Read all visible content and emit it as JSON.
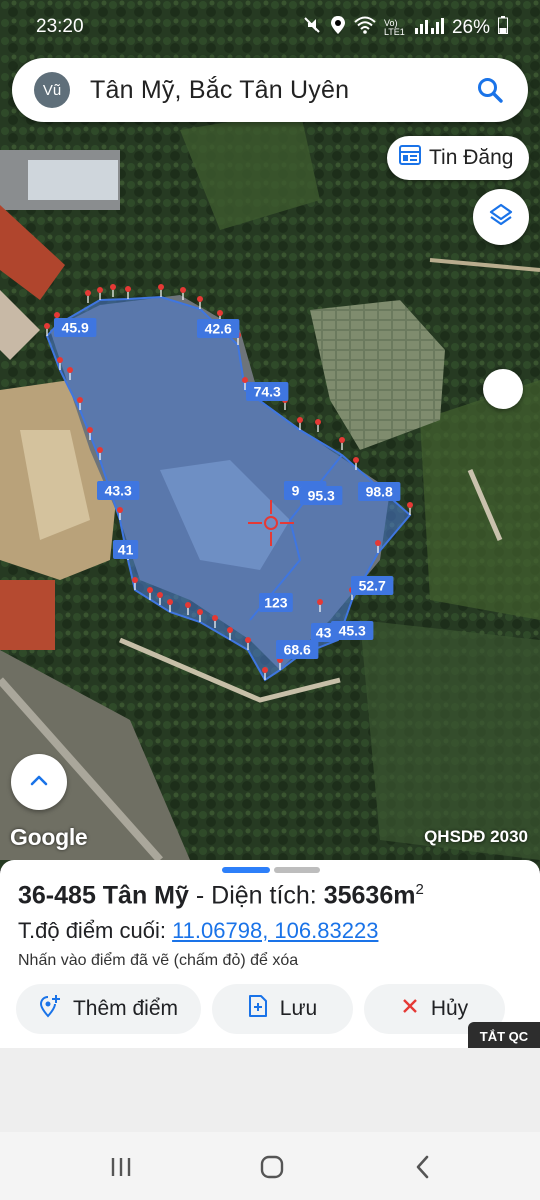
{
  "status_bar": {
    "time": "23:20",
    "network": "Vo) LTE1",
    "battery": "26%"
  },
  "search": {
    "avatar_initials": "Vũ",
    "query": "Tân Mỹ, Bắc Tân Uyên"
  },
  "map": {
    "tin_dang_label": "Tin Đăng",
    "google_label": "Google",
    "overlay_label": "QHSDĐ 2030",
    "edge_lengths": [
      "45.9",
      "42.6",
      "74.3",
      "99.7",
      "98.8",
      "43.3",
      "41",
      "123",
      "52.7",
      "43",
      "45.3",
      "68.6",
      "95.3"
    ]
  },
  "sheet": {
    "parcel_name": "36-485 Tân Mỹ",
    "separator": " - ",
    "area_label": "Diện tích: ",
    "area_value": "35636m",
    "area_unit_exp": "2",
    "last_point_label": "T.độ điểm cuối: ",
    "last_point_coords": "11.06798, 106.83223",
    "hint": "Nhấn vào điểm đã vẽ (chấm đỏ) để xóa",
    "add_point_label": "Thêm điểm",
    "save_label": "Lưu",
    "cancel_label": "Hủy"
  },
  "ad": {
    "hide_ads_label": "TẮT QC"
  },
  "colors": {
    "accent": "#1a73e8",
    "polygon_fill": "#4a7bd6",
    "vertex_marker": "#e53935",
    "cancel_icon": "#e53935"
  }
}
